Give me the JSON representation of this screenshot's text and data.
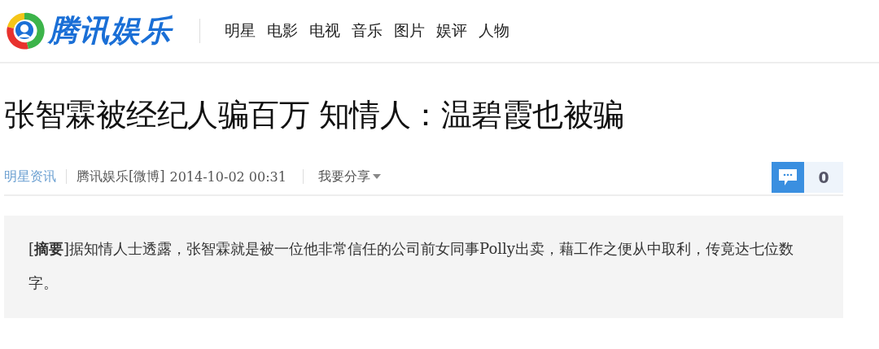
{
  "header": {
    "logo_text": "腾讯娱乐",
    "nav": [
      {
        "label": "明星"
      },
      {
        "label": "电影"
      },
      {
        "label": "电视"
      },
      {
        "label": "音乐"
      },
      {
        "label": "图片"
      },
      {
        "label": "娱评"
      },
      {
        "label": "人物"
      }
    ]
  },
  "article": {
    "title": "张智霖被经纪人骗百万 知情人：温碧霞也被骗",
    "meta": {
      "category": "明星资讯",
      "source": "腾讯娱乐[微博]",
      "time": "2014-10-02 00:31",
      "share": "我要分享",
      "comment_count": "0"
    },
    "summary": "[**摘要**]据知情人士透露，张智霖就是被一位他非常信任的公司前女同事Polly出卖，藉工作之便从中取利，传竟达七位数字。"
  }
}
